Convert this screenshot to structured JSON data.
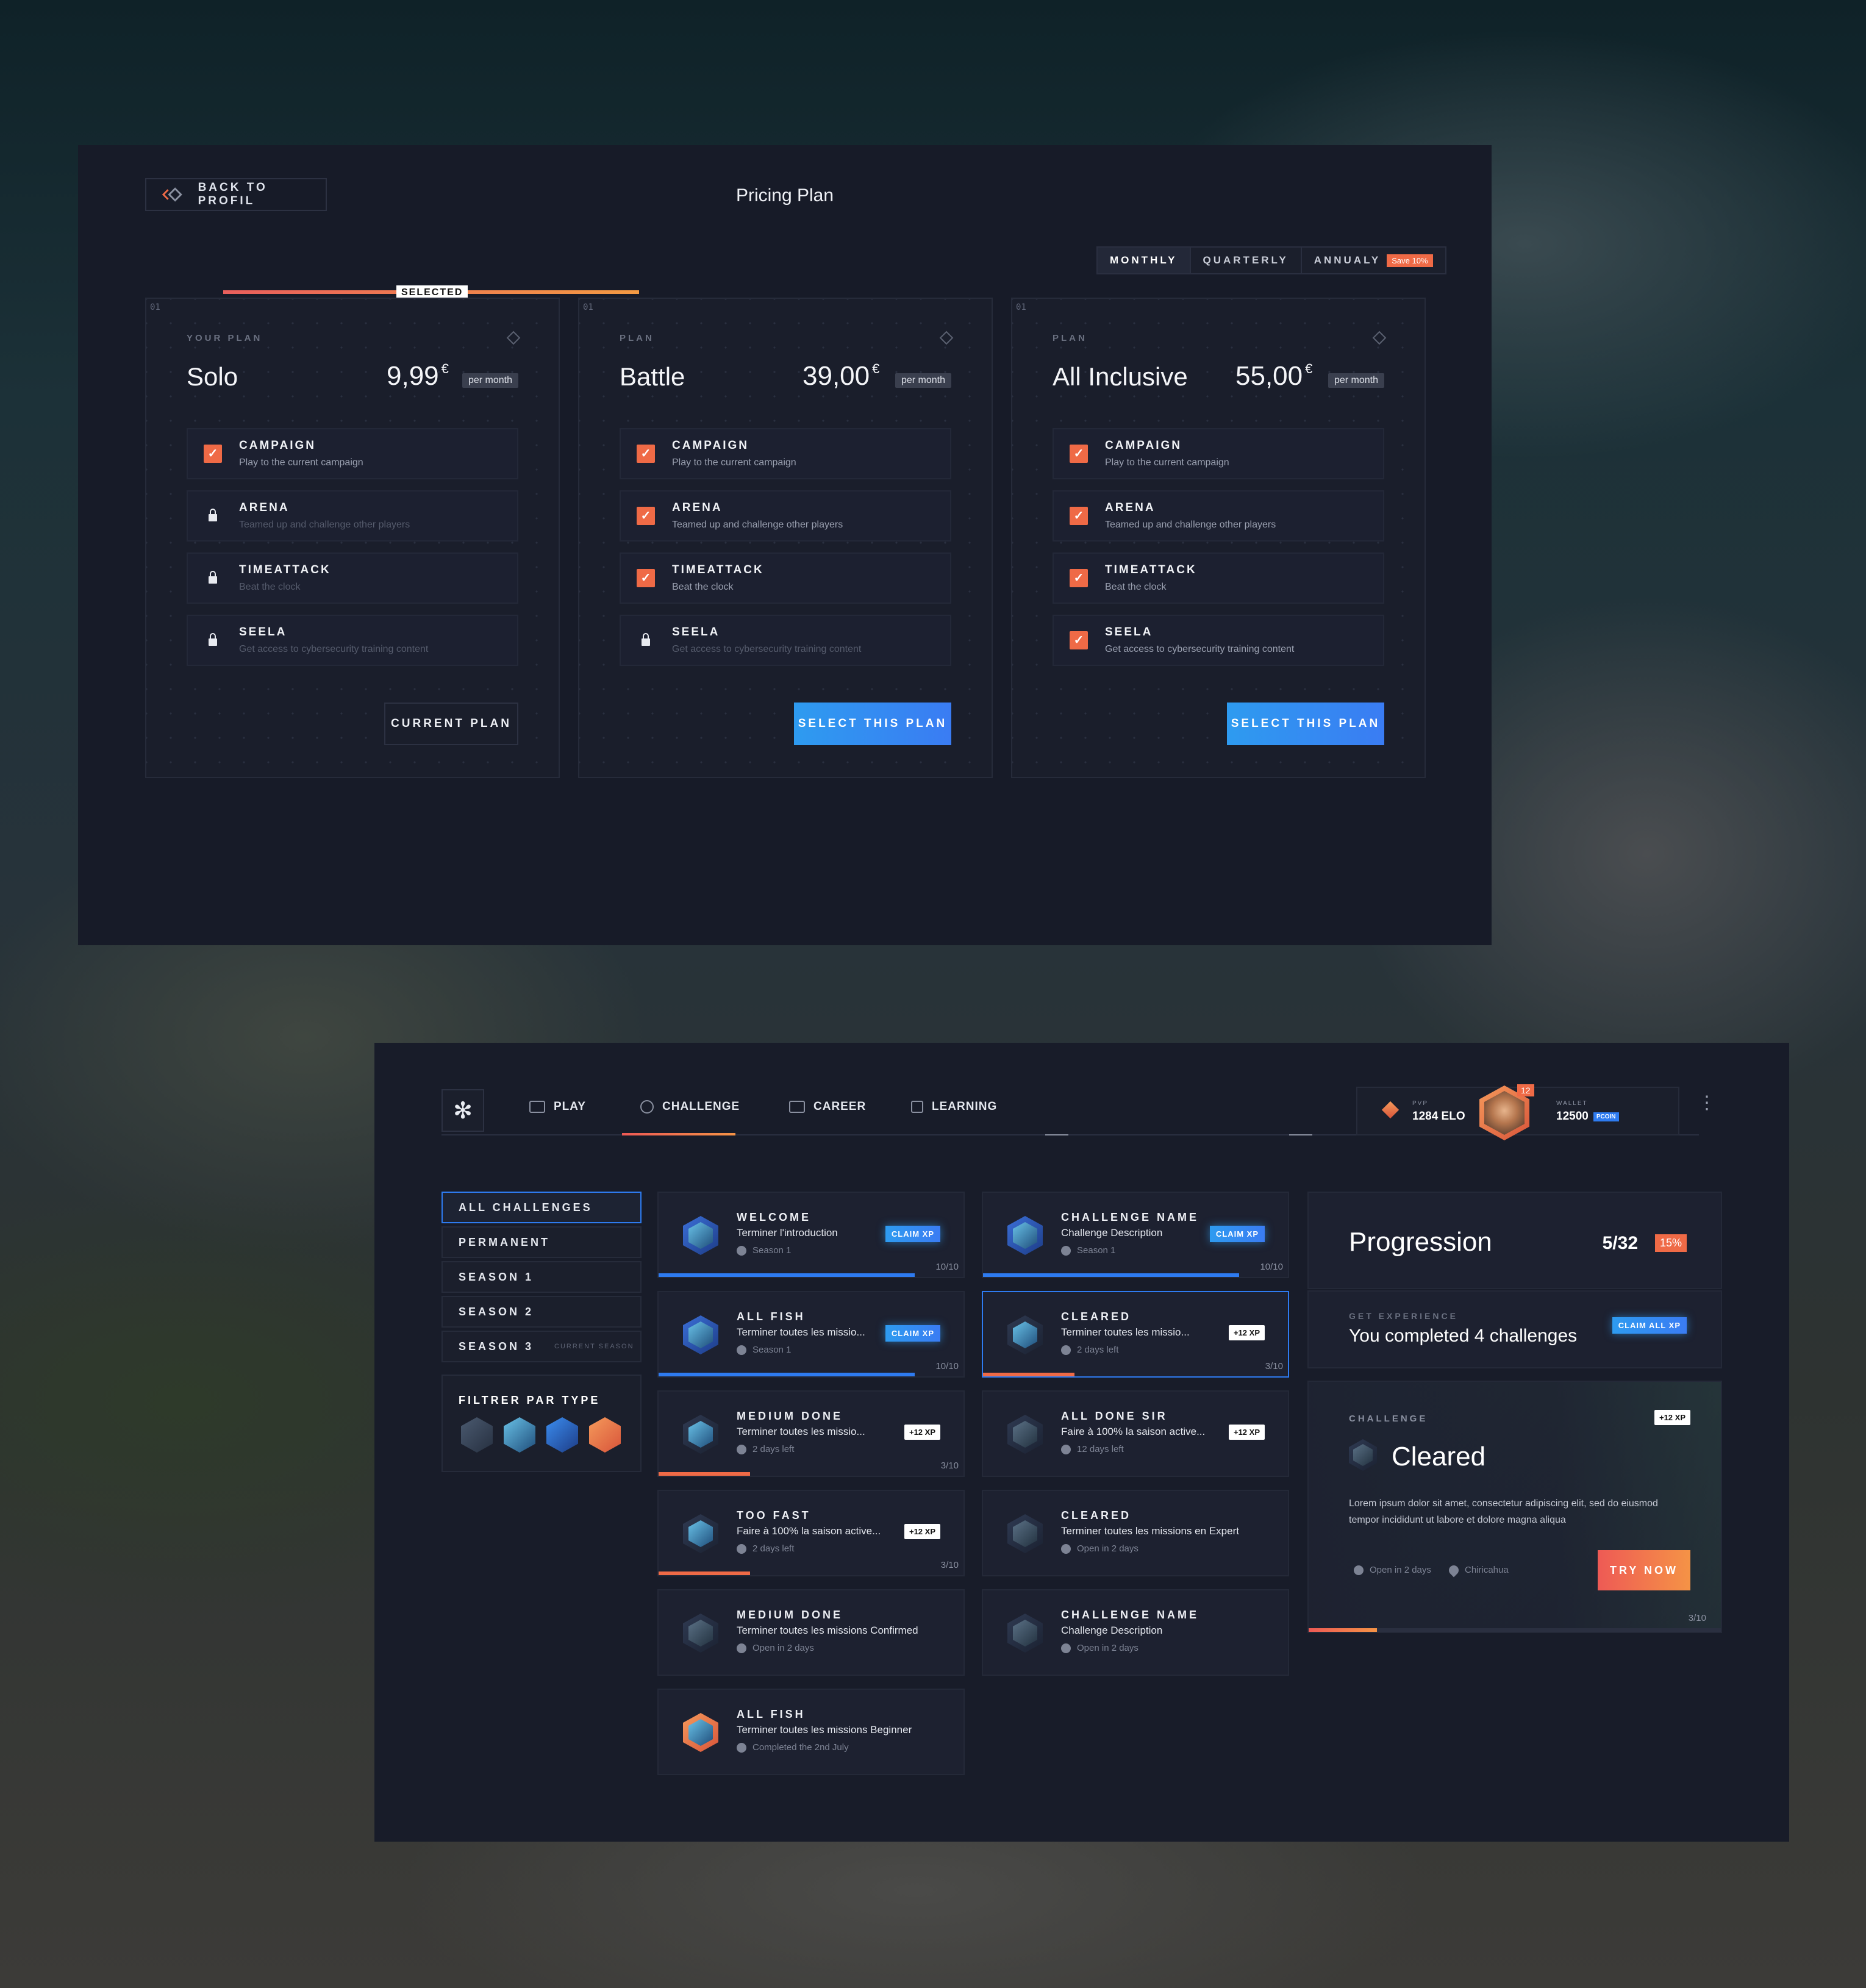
{
  "pricing": {
    "back_label": "BACK TO PROFIL",
    "title": "Pricing Plan",
    "billing_tabs": [
      {
        "label": "MONTHLY",
        "active": true
      },
      {
        "label": "QUARTERLY",
        "active": false
      },
      {
        "label": "ANNUALY",
        "active": false,
        "badge": "Save 10%"
      }
    ],
    "selected_badge": "SELECTED",
    "plans": [
      {
        "number": "01",
        "label": "YOUR PLAN",
        "name": "Solo",
        "price": "9,99",
        "currency": "€",
        "period": "per month",
        "selected": true,
        "features": [
          {
            "title": "CAMPAIGN",
            "desc": "Play to the current campaign",
            "included": true
          },
          {
            "title": "ARENA",
            "desc": "Teamed up and challenge other players",
            "included": false
          },
          {
            "title": "TIMEATTACK",
            "desc": "Beat the clock",
            "included": false
          },
          {
            "title": "SEELA",
            "desc": "Get access to cybersecurity training content",
            "included": false
          }
        ],
        "button": "CURRENT PLAN"
      },
      {
        "number": "01",
        "label": "PLAN",
        "name": "Battle",
        "price": "39,00",
        "currency": "€",
        "period": "per month",
        "selected": false,
        "features": [
          {
            "title": "CAMPAIGN",
            "desc": "Play to the current campaign",
            "included": true
          },
          {
            "title": "ARENA",
            "desc": "Teamed up and challenge other players",
            "included": true
          },
          {
            "title": "TIMEATTACK",
            "desc": "Beat the clock",
            "included": true
          },
          {
            "title": "SEELA",
            "desc": "Get access to cybersecurity training content",
            "included": false
          }
        ],
        "button": "SELECT THIS PLAN"
      },
      {
        "number": "01",
        "label": "PLAN",
        "name": "All Inclusive",
        "price": "55,00",
        "currency": "€",
        "period": "per month",
        "selected": false,
        "features": [
          {
            "title": "CAMPAIGN",
            "desc": "Play to the current campaign",
            "included": true
          },
          {
            "title": "ARENA",
            "desc": "Teamed up and challenge other players",
            "included": true
          },
          {
            "title": "TIMEATTACK",
            "desc": "Beat the clock",
            "included": true
          },
          {
            "title": "SEELA",
            "desc": "Get access to cybersecurity training content",
            "included": true
          }
        ],
        "button": "SELECT THIS PLAN"
      }
    ]
  },
  "app": {
    "logo_icon": "snowflake-icon",
    "nav": [
      {
        "label": "PLAY",
        "icon": "gamepad-icon"
      },
      {
        "label": "CHALLENGE",
        "icon": "target-icon",
        "active": true
      },
      {
        "label": "CAREER",
        "icon": "chart-icon"
      },
      {
        "label": "LEARNING",
        "icon": "book-icon"
      }
    ],
    "pvp_label": "PVP",
    "elo": "1284 ELO",
    "level_badge": "12",
    "wallet_label": "WALLET",
    "wallet_value": "12500",
    "wallet_unit": "PCOIN",
    "sidebar": [
      {
        "label": "ALL CHALLENGES",
        "active": true
      },
      {
        "label": "PERMANENT"
      },
      {
        "label": "SEASON 1"
      },
      {
        "label": "SEASON 2"
      },
      {
        "label": "SEASON 3",
        "note": "CURRENT SEASON"
      }
    ],
    "filter_title": "FILTRER PAR TYPE",
    "challenges_left": [
      {
        "title": "WELCOME",
        "desc": "Terminer l'introduction",
        "meta": "Season 1",
        "action": "CLAIM XP",
        "count": "10/10",
        "progress": 1.0,
        "bar": "#2e7bf0"
      },
      {
        "title": "ALL FISH",
        "desc": "Terminer toutes les missio...",
        "meta": "Season 1",
        "action": "CLAIM XP",
        "count": "10/10",
        "progress": 1.0,
        "bar": "#2e7bf0"
      },
      {
        "title": "MEDIUM DONE",
        "desc": "Terminer toutes les missio...",
        "meta": "2 days left",
        "action": "+12 XP",
        "count": "3/10",
        "progress": 0.3,
        "bar": "#ef6a46"
      },
      {
        "title": "TOO FAST",
        "desc": "Faire à 100% la saison active...",
        "meta": "2 days left",
        "action": "+12 XP",
        "count": "3/10",
        "progress": 0.3,
        "bar": "#ef6a46"
      },
      {
        "title": "MEDIUM DONE",
        "desc": "Terminer toutes les missions Confirmed",
        "meta": "Open in 2 days",
        "locked": true
      },
      {
        "title": "ALL FISH",
        "desc": "Terminer toutes les missions Beginner",
        "meta": "Completed the 2nd July",
        "done": true
      }
    ],
    "challenges_right": [
      {
        "title": "CHALLENGE NAME",
        "desc": "Challenge Description",
        "meta": "Season 1",
        "action": "CLAIM XP",
        "count": "10/10",
        "progress": 1.0,
        "bar": "#2e7bf0"
      },
      {
        "title": "CLEARED",
        "desc": "Terminer toutes les missio...",
        "meta": "2 days left",
        "action": "+12 XP",
        "count": "3/10",
        "progress": 0.3,
        "bar": "#ef6a46",
        "selected": true
      },
      {
        "title": "ALL DONE SIR",
        "desc": "Faire à 100% la saison active...",
        "meta": "12 days left",
        "action": "+12 XP",
        "locked": true
      },
      {
        "title": "CLEARED",
        "desc": "Terminer toutes les missions en Expert",
        "meta": "Open in 2 days",
        "locked": true
      },
      {
        "title": "CHALLENGE NAME",
        "desc": "Challenge Description",
        "meta": "Open in 2 days",
        "locked": true
      }
    ],
    "progression": {
      "title": "Progression",
      "count": "5/32",
      "percent": "15%",
      "get_exp_label": "GET EXPERIENCE",
      "summary": "You completed 4 challenges",
      "claim_all": "CLAIM ALL XP"
    },
    "detail": {
      "label": "CHALLENGE",
      "xp": "+12 XP",
      "title": "Cleared",
      "desc": "Lorem ipsum dolor sit amet, consectetur adipiscing elit, sed do eiusmod tempor incididunt ut labore et dolore magna aliqua",
      "open": "Open in 2 days",
      "location": "Chiricahua",
      "button": "TRY NOW",
      "count": "3/10",
      "progress": 0.3
    }
  }
}
